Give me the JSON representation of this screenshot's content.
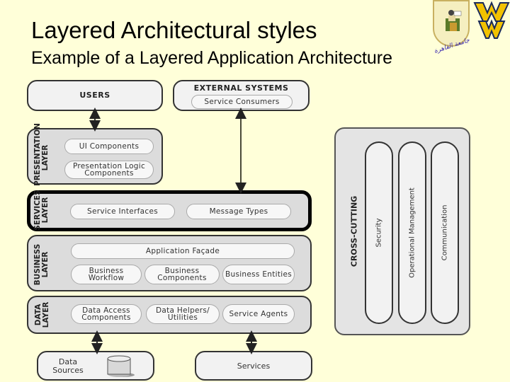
{
  "slide": {
    "title": "Layered Architectural styles",
    "subtitle": "Example of a Layered Application Architecture",
    "logos": [
      "university-seal-logo",
      "wv-logo"
    ],
    "logo_script": "جامعة القاهرة"
  },
  "diagram": {
    "users": {
      "label": "USERS"
    },
    "external_systems": {
      "label": "EXTERNAL SYSTEMS",
      "components": [
        "Service Consumers"
      ]
    },
    "presentation_layer": {
      "label_line1": "PRESENTATION",
      "label_line2": "LAYER",
      "components": [
        "UI Components",
        "Presentation Logic Components"
      ]
    },
    "services_layer": {
      "label_line1": "SERVICES",
      "label_line2": "LAYER",
      "components": [
        "Service Interfaces",
        "Message Types"
      ]
    },
    "business_layer": {
      "label_line1": "BUSINESS",
      "label_line2": "LAYER",
      "facade": "Application Façade",
      "components": [
        "Business Workflow",
        "Business Components",
        "Business Entities"
      ]
    },
    "data_layer": {
      "label_line1": "DATA",
      "label_line2": "LAYER",
      "components": [
        "Data Access Components",
        "Data Helpers/ Utilities",
        "Service Agents"
      ]
    },
    "data_sources": {
      "label": "Data Sources"
    },
    "services": {
      "label": "Services"
    },
    "cross_cutting": {
      "label": "CROSS-CUTTING",
      "components": [
        "Security",
        "Operational Management",
        "Communication"
      ]
    }
  }
}
